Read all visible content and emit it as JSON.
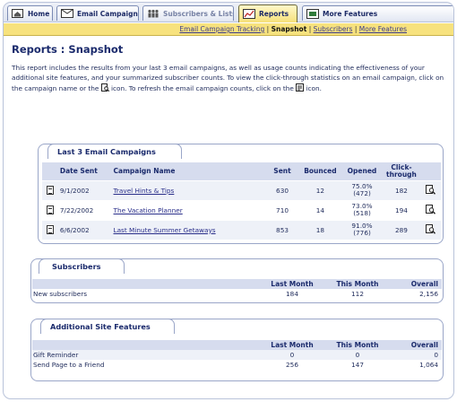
{
  "tabs": [
    {
      "label": "Home",
      "icon": "home-icon"
    },
    {
      "label": "Email Campaigns",
      "icon": "envelope-icon"
    },
    {
      "label": "Subscribers & Lists",
      "icon": "people-icon"
    },
    {
      "label": "Reports",
      "icon": "chart-icon"
    },
    {
      "label": "More Features",
      "icon": "features-icon"
    }
  ],
  "subnav": {
    "items": [
      "Email Campaign Tracking",
      "Snapshot",
      "Subscribers",
      "More Features"
    ],
    "separator": "|"
  },
  "page": {
    "title": "Reports : Snapshot",
    "intro_1": "This report includes the results from your last 3 email campaigns, as well as usage counts indicating the effectiveness of your additional site features, and your summarized subscriber counts. To view the click-through statistics on an email campaign, click on the campaign name or the ",
    "intro_2": " icon. To refresh the email campaign counts, click on the ",
    "intro_3": " icon."
  },
  "campaigns": {
    "heading": "Last 3 Email Campaigns",
    "columns": [
      "Date Sent",
      "Campaign Name",
      "Sent",
      "Bounced",
      "Opened",
      "Click-through"
    ],
    "rows": [
      {
        "date": "9/1/2002",
        "name": "Travel Hints & Tips",
        "sent": "630",
        "bounced": "12",
        "opened_pct": "75.0%",
        "opened_count": "(472)",
        "clicks": "182"
      },
      {
        "date": "7/22/2002",
        "name": "The Vacation Planner",
        "sent": "710",
        "bounced": "14",
        "opened_pct": "73.0%",
        "opened_count": "(518)",
        "clicks": "194"
      },
      {
        "date": "6/6/2002",
        "name": "Last Minute Summer Getaways",
        "sent": "853",
        "bounced": "18",
        "opened_pct": "91.0%",
        "opened_count": "(776)",
        "clicks": "289"
      }
    ]
  },
  "subscribers": {
    "heading": "Subscribers",
    "columns": [
      "Last Month",
      "This Month",
      "Overall"
    ],
    "rows": [
      {
        "label": "New subscribers",
        "last": "184",
        "this": "112",
        "overall": "2,156"
      }
    ]
  },
  "features": {
    "heading": "Additional Site Features",
    "columns": [
      "Last Month",
      "This Month",
      "Overall"
    ],
    "rows": [
      {
        "label": "Gift Reminder",
        "last": "0",
        "this": "0",
        "overall": "0"
      },
      {
        "label": "Send Page to a Friend",
        "last": "256",
        "this": "147",
        "overall": "1,064"
      }
    ]
  },
  "colors": {
    "accent_yellow": "#f7e27e",
    "header_blue": "#d6dcee",
    "link": "#2a2f8a"
  }
}
